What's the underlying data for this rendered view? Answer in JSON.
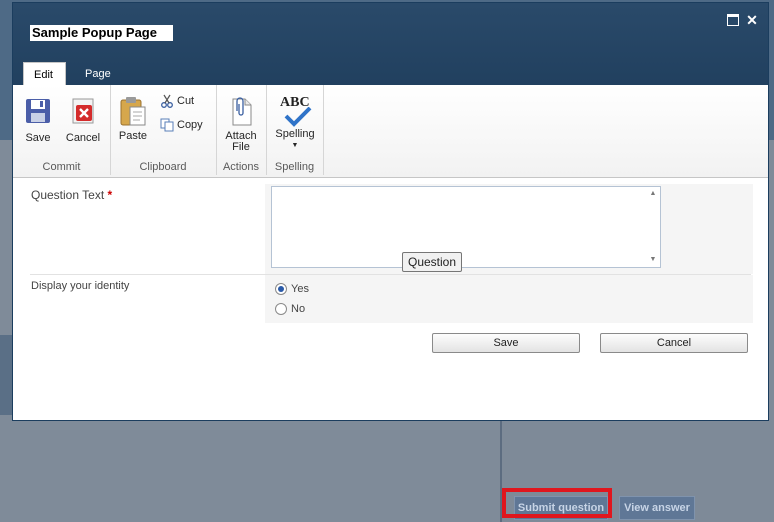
{
  "dialog": {
    "title": "Sample Popup Page"
  },
  "ribbon": {
    "tabs": [
      {
        "label": "Edit",
        "active": true
      },
      {
        "label": "Page",
        "active": false
      }
    ],
    "groups": {
      "commit": {
        "label": "Commit",
        "save": "Save",
        "cancel": "Cancel"
      },
      "clipboard": {
        "label": "Clipboard",
        "paste": "Paste",
        "cut": "Cut",
        "copy": "Copy"
      },
      "actions": {
        "label": "Actions",
        "attach_line1": "Attach",
        "attach_line2": "File"
      },
      "spelling": {
        "label": "Spelling",
        "spelling": "Spelling",
        "abc": "ABC"
      }
    }
  },
  "form": {
    "question_label": "Question Text",
    "required_marker": "*",
    "question_value": "",
    "tooltip": "Question",
    "identity_label": "Display your identity",
    "options": [
      {
        "label": "Yes",
        "checked": true
      },
      {
        "label": "No",
        "checked": false
      }
    ],
    "save_button": "Save",
    "cancel_button": "Cancel"
  },
  "background": {
    "submit_button": "Submit question",
    "view_button": "View answer"
  },
  "colors": {
    "header": "#21405f",
    "highlight": "#e0161e",
    "required": "#cc0000"
  }
}
